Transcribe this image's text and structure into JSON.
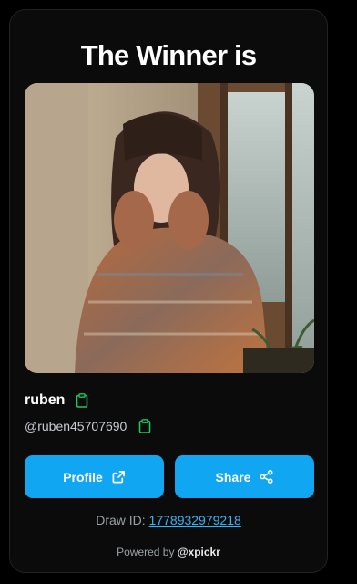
{
  "header": {
    "title": "The Winner is"
  },
  "winner": {
    "photo_icon": "winner-photo",
    "name": "ruben",
    "handle": "@ruben45707690"
  },
  "actions": {
    "profile_label": "Profile",
    "profile_icon": "external-link-icon",
    "share_label": "Share",
    "share_icon": "share-icon"
  },
  "draw": {
    "label": "Draw ID: ",
    "id": "1778932979218"
  },
  "footer": {
    "powered_label": "Powered by ",
    "brand": "@xpickr"
  },
  "colors": {
    "accent": "#11a6f2",
    "copy_icon": "#22c55e",
    "background": "#0b0b0c"
  }
}
